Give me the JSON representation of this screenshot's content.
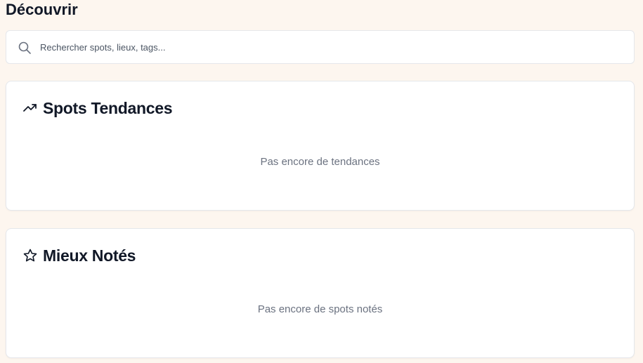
{
  "page": {
    "title": "Découvrir"
  },
  "search": {
    "placeholder": "Rechercher spots, lieux, tags...",
    "icon": "search-icon"
  },
  "sections": [
    {
      "title": "Spots Tendances",
      "icon": "trending-up-icon",
      "empty_text": "Pas encore de tendances"
    },
    {
      "title": "Mieux Notés",
      "icon": "star-icon",
      "empty_text": "Pas encore de spots notés"
    }
  ],
  "colors": {
    "background": "#fdf6ef",
    "card": "#ffffff",
    "text": "#111827",
    "muted": "#6b7280"
  }
}
